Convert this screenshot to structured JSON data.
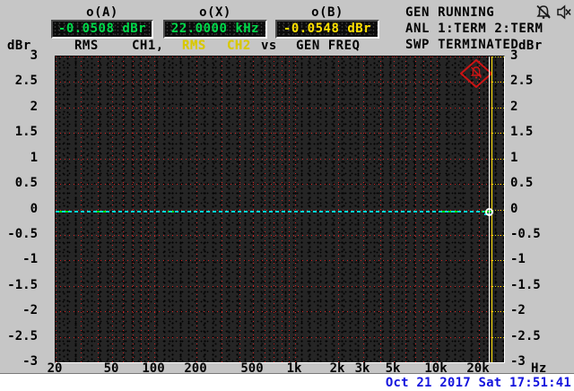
{
  "header": {
    "readouts": [
      {
        "label": "o(A)",
        "value": "-0.0508 dBr",
        "color": "#00d94a"
      },
      {
        "label": "o(X)",
        "value": "22.0000 kHz",
        "color": "#00d94a"
      },
      {
        "label": "o(B)",
        "value": "-0.0548 dBr",
        "color": "#ffe000"
      }
    ],
    "status_lines": [
      "GEN RUNNING",
      "ANL 1:TERM 2:TERM",
      "SWP TERMINATED"
    ],
    "icons": [
      "bell-muted-icon",
      "speaker-muted-icon"
    ]
  },
  "subtitle": {
    "left_unit": "dBr",
    "trace1_function": "RMS",
    "trace1_channel": "CH1,",
    "trace2_function": "RMS",
    "trace2_channel": "CH2",
    "versus": "vs",
    "x_source": "GEN FREQ",
    "right_unit": "dBr"
  },
  "footer": {
    "x_unit": "Hz",
    "timestamp": "Oct 21 2017 Sat 17:51:41"
  },
  "chart_data": {
    "type": "line",
    "title": "RMS CH1, RMS CH2 vs GEN FREQ",
    "x_axis": {
      "unit": "Hz",
      "scale": "log",
      "min": 20,
      "max": 30000,
      "tick_labels": [
        "20",
        "50",
        "100",
        "200",
        "500",
        "1k",
        "2k",
        "3k",
        "5k",
        "10k",
        "20k"
      ],
      "tick_values": [
        20,
        50,
        100,
        200,
        500,
        1000,
        2000,
        3000,
        5000,
        10000,
        20000
      ],
      "minor_gridlines": [
        30,
        40,
        60,
        70,
        80,
        90,
        300,
        400,
        600,
        700,
        800,
        900,
        4000,
        6000,
        7000,
        8000,
        9000
      ]
    },
    "y_axis": {
      "unit": "dBr",
      "min": -3,
      "max": 3,
      "step": 0.5,
      "tick_labels": [
        "3",
        "2.5",
        "2",
        "1.5",
        "1",
        "0.5",
        "0",
        "-0.5",
        "-1",
        "-1.5",
        "-2",
        "-2.5",
        "-3"
      ]
    },
    "grid": {
      "style": "dotted",
      "color": "#d42222",
      "background": "dark-dithered"
    },
    "series": [
      {
        "name": "RMS CH1",
        "color": "#00e000",
        "line_style": "solid",
        "flat_level_dBr": -0.0508,
        "x_range_hz": [
          20,
          22000
        ]
      },
      {
        "name": "RMS CH2",
        "color": "#00e0e0",
        "line_style": "dashed",
        "flat_level_dBr": -0.0548,
        "x_range_hz": [
          20,
          22000
        ]
      }
    ],
    "cursor": {
      "x_hz": 22000,
      "color": "#ffe000",
      "secondary_color": "#ffffff",
      "marker": "white-circle"
    },
    "annotations": [
      "alert-diamond-icon top-right of plot"
    ],
    "legend_position": "none"
  }
}
